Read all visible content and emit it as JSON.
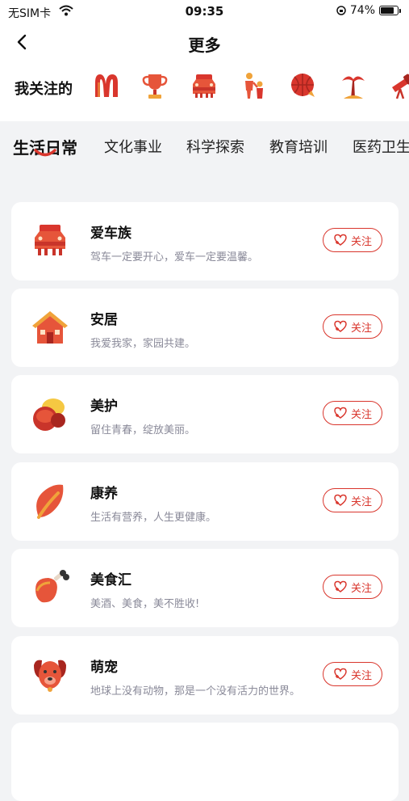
{
  "status": {
    "carrier": "无SIM卡",
    "time": "09:35",
    "battery": "74%"
  },
  "nav": {
    "title": "更多",
    "back_icon": "chevron-left-icon"
  },
  "followed": {
    "label": "我关注的",
    "items": [
      "mcdonalds-icon",
      "trophy-icon",
      "car-icon",
      "family-icon",
      "basketball-icon",
      "palm-tree-icon",
      "telescope-icon"
    ]
  },
  "tabs": [
    {
      "label": "生活日常",
      "active": true
    },
    {
      "label": "文化事业",
      "active": false
    },
    {
      "label": "科学探索",
      "active": false
    },
    {
      "label": "教育培训",
      "active": false
    },
    {
      "label": "医药卫生",
      "active": false
    }
  ],
  "categories": [
    {
      "title": "爱车族",
      "desc": "驾车一定要开心，爱车一定要温馨。",
      "icon": "car-icon",
      "button": "关注"
    },
    {
      "title": "安居",
      "desc": "我爱我家，家园共建。",
      "icon": "house-icon",
      "button": "关注"
    },
    {
      "title": "美护",
      "desc": "留住青春，绽放美丽。",
      "icon": "cosmetics-icon",
      "button": "关注"
    },
    {
      "title": "康养",
      "desc": "生活有营养，人生更健康。",
      "icon": "leaf-icon",
      "button": "关注"
    },
    {
      "title": "美食汇",
      "desc": "美酒、美食，美不胜收!",
      "icon": "ham-icon",
      "button": "关注"
    },
    {
      "title": "萌宠",
      "desc": "地球上没有动物，那是一个没有活力的世界。",
      "icon": "dog-icon",
      "button": "关注"
    }
  ],
  "colors": {
    "accent": "#d9362d",
    "page_bg": "#f2f3f5",
    "card_bg": "#ffffff"
  }
}
